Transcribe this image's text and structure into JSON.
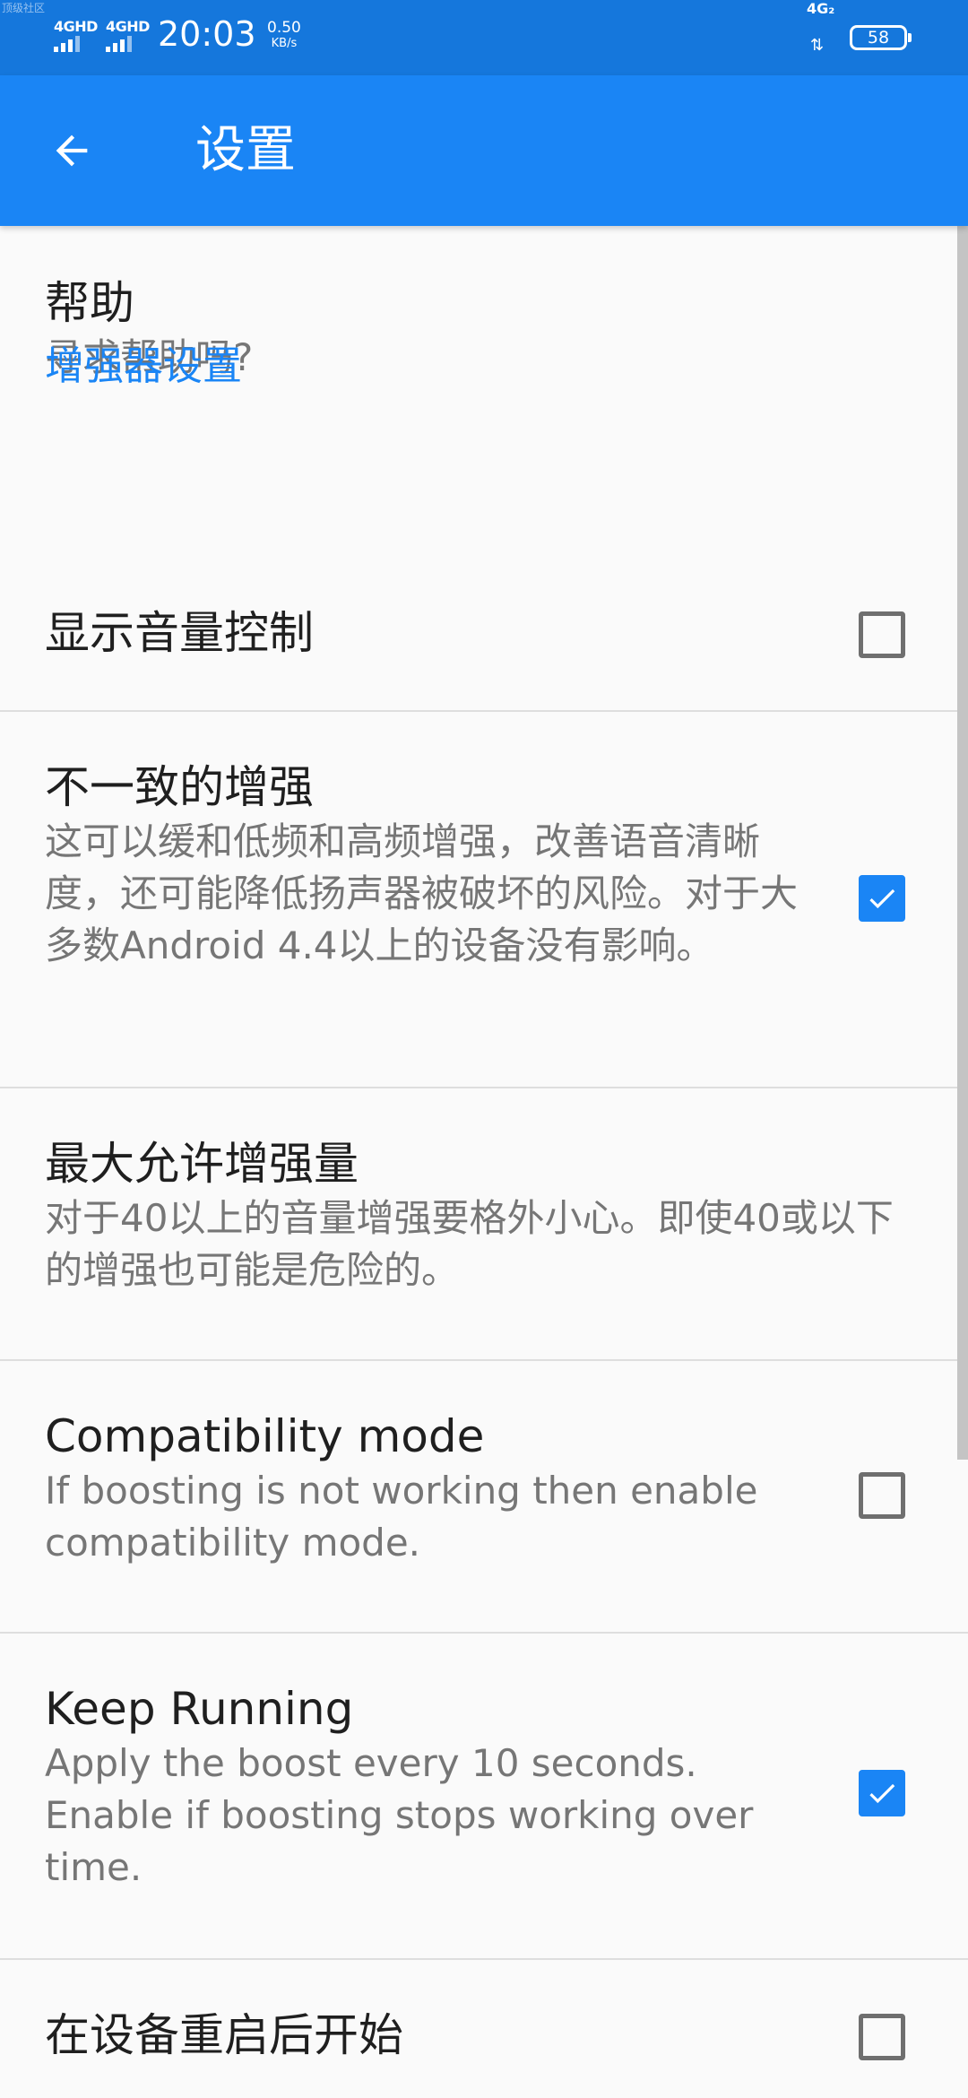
{
  "status_bar": {
    "watermark": "顶级社区",
    "sim1_label": "4GHD",
    "sim2_label": "4GHD",
    "time": "20:03",
    "speed_value": "0.50",
    "speed_unit": "KB/s",
    "network_type": "4G₂",
    "battery": "58"
  },
  "app_bar": {
    "title": "设置",
    "back_icon": "arrow-back-icon"
  },
  "colors": {
    "status_bar": "#1577dc",
    "app_bar": "#1a85f5",
    "accent": "#1a85f5",
    "background": "#fafafa"
  },
  "prefs": {
    "help": {
      "title": "帮助",
      "summary": "寻求帮助吗?"
    },
    "category": "增强器设置",
    "show_volume": {
      "title": "显示音量控制",
      "checked": false
    },
    "inconsistent": {
      "title": "不一致的增强",
      "summary": "这可以缓和低频和高频增强，改善语音清晰度，还可能降低扬声器被破坏的风险。对于大多数Android 4.4以上的设备没有影响。",
      "checked": true
    },
    "max_boost": {
      "title": "最大允许增强量",
      "summary": "对于40以上的音量增强要格外小心。即使40或以下的增强也可能是危险的。"
    },
    "compat": {
      "title": "Compatibility mode",
      "summary": "If boosting is not working then enable compatibility mode.",
      "checked": false
    },
    "keep_running": {
      "title": "Keep Running",
      "summary": "Apply the boost every 10 seconds. Enable if boosting stops working over time.",
      "checked": true
    },
    "start_on_boot": {
      "title": "在设备重启后开始",
      "checked": false
    }
  }
}
